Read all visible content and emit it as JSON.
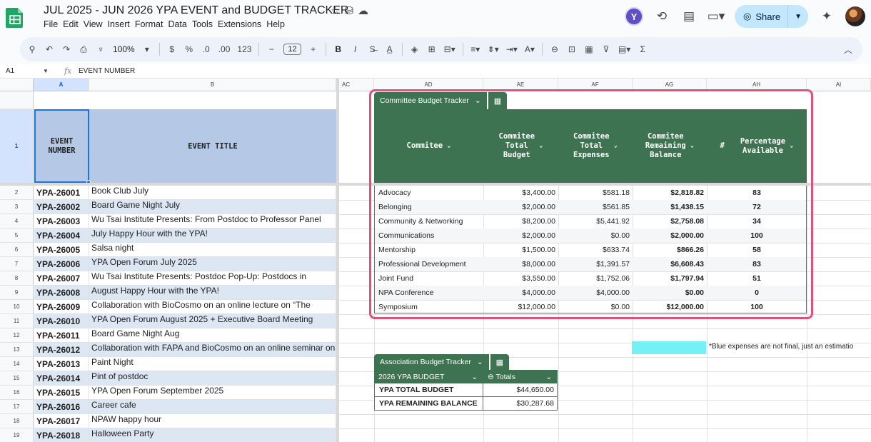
{
  "app": {
    "doc_title": "JUL 2025 - JUN 2026 YPA EVENT and BUDGET TRACKER",
    "menu": [
      "File",
      "Edit",
      "View",
      "Insert",
      "Format",
      "Data",
      "Tools",
      "Extensions",
      "Help"
    ],
    "avatar_letter": "Y",
    "share_label": "Share"
  },
  "toolbar": {
    "zoom": "100%",
    "currency": "$",
    "percent": "%",
    "dec_less": ".0",
    "dec_more": ".00",
    "number_format": "123",
    "font_size": "12",
    "bold": "B",
    "italic": "I"
  },
  "formula_bar": {
    "cell_ref": "A1",
    "formula": "EVENT NUMBER"
  },
  "columns": [
    "A",
    "B",
    "AC",
    "AD",
    "AE",
    "AF",
    "AG",
    "AH",
    "AI"
  ],
  "header_row": {
    "row_number": "1",
    "a": "EVENT\nNUMBER",
    "b": "EVENT TITLE"
  },
  "events": [
    {
      "row": "2",
      "number": "YPA-26001",
      "title": "Book Club July"
    },
    {
      "row": "3",
      "number": "YPA-26002",
      "title": "Board Game Night July"
    },
    {
      "row": "4",
      "number": "YPA-26003",
      "title": "Wu Tsai Institute Presents: From Postdoc to Professor Panel"
    },
    {
      "row": "5",
      "number": "YPA-26004",
      "title": "July Happy Hour with the YPA!"
    },
    {
      "row": "6",
      "number": "YPA-26005",
      "title": "Salsa night"
    },
    {
      "row": "7",
      "number": "YPA-26006",
      "title": "YPA Open Forum July 2025"
    },
    {
      "row": "8",
      "number": "YPA-26007",
      "title": "Wu Tsai Institute Presents: Postdoc Pop-Up: Postdocs in"
    },
    {
      "row": "9",
      "number": "YPA-26008",
      "title": "August Happy Hour with the YPA!"
    },
    {
      "row": "10",
      "number": "YPA-26009",
      "title": "Collaboration with BioCosmo on an online lecture on “The"
    },
    {
      "row": "11",
      "number": "YPA-26010",
      "title": "YPA Open Forum August 2025 + Executive Board Meeting"
    },
    {
      "row": "12",
      "number": "YPA-26011",
      "title": "Board Game Night Aug"
    },
    {
      "row": "13",
      "number": "YPA-26012",
      "title": "Collaboration with FAPA and BioCosmo on an online seminar on"
    },
    {
      "row": "14",
      "number": "YPA-26013",
      "title": "Paint Night"
    },
    {
      "row": "15",
      "number": "YPA-26014",
      "title": "Pint of postdoc"
    },
    {
      "row": "16",
      "number": "YPA-26015",
      "title": "YPA Open Forum September 2025"
    },
    {
      "row": "17",
      "number": "YPA-26016",
      "title": "Career cafe"
    },
    {
      "row": "18",
      "number": "YPA-26017",
      "title": "NPAW happy hour"
    },
    {
      "row": "19",
      "number": "YPA-26018",
      "title": "Halloween Party"
    }
  ],
  "committee_table": {
    "tab_label": "Committee Budget Tracker",
    "headers": [
      "Commitee",
      "Commitee\nTotal\nBudget",
      "Commitee\nTotal\nExpenses",
      "Commitee\nRemaining\nBalance",
      "Percentage\nAvailable"
    ],
    "hash_symbol": "#",
    "rows": [
      {
        "name": "Advocacy",
        "budget": "$3,400.00",
        "expenses": "$581.18",
        "remaining": "$2,818.82",
        "pct": "83"
      },
      {
        "name": "Belonging",
        "budget": "$2,000.00",
        "expenses": "$561.85",
        "remaining": "$1,438.15",
        "pct": "72"
      },
      {
        "name": "Community & Networking",
        "budget": "$8,200.00",
        "expenses": "$5,441.92",
        "remaining": "$2,758.08",
        "pct": "34"
      },
      {
        "name": "Communications",
        "budget": "$2,000.00",
        "expenses": "$0.00",
        "remaining": "$2,000.00",
        "pct": "100"
      },
      {
        "name": "Mentorship",
        "budget": "$1,500.00",
        "expenses": "$633.74",
        "remaining": "$866.26",
        "pct": "58"
      },
      {
        "name": "Professional Development",
        "budget": "$8,000.00",
        "expenses": "$1,391.57",
        "remaining": "$6,608.43",
        "pct": "83"
      },
      {
        "name": "Joint Fund",
        "budget": "$3,550.00",
        "expenses": "$1,752.06",
        "remaining": "$1,797.94",
        "pct": "51"
      },
      {
        "name": "NPA Conference",
        "budget": "$4,000.00",
        "expenses": "$4,000.00",
        "remaining": "$0.00",
        "pct": "0"
      },
      {
        "name": "Symposium",
        "budget": "$12,000.00",
        "expenses": "$0.00",
        "remaining": "$12,000.00",
        "pct": "100"
      }
    ]
  },
  "association_table": {
    "tab_label": "Association Budget Tracker",
    "col1": "2026 YPA BUDGET",
    "col2": "Totals",
    "rows": [
      {
        "label": "YPA TOTAL BUDGET",
        "value": "$44,650.00"
      },
      {
        "label": "YPA REMAINING BALANCE",
        "value": "$30,287.68"
      }
    ]
  },
  "note": "*Blue expenses are not final, just an estimatio",
  "colors": {
    "table_green": "#3d7350",
    "row_blue": "#dde7f3",
    "highlight_cyan": "#73f1f7",
    "annotation_pink": "#e0507a"
  }
}
